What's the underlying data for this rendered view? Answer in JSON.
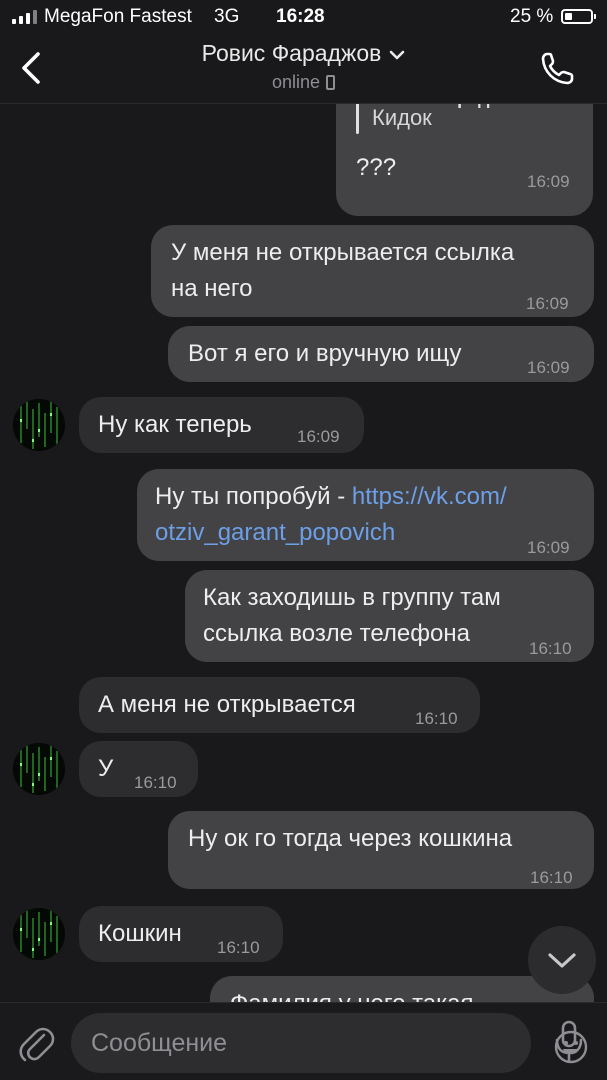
{
  "status_bar": {
    "carrier": "MegaFon Fastest",
    "network": "3G",
    "time": "16:28",
    "battery": "25 %"
  },
  "header": {
    "contact_name": "Ровис Фараджов",
    "status": "online"
  },
  "messages": [
    {
      "direction": "out",
      "reply_to_name": "Ровис Фараджов",
      "reply_to_text": "Кидок",
      "text": "???",
      "time": "16:09"
    },
    {
      "direction": "out",
      "text_lines": [
        "У меня не открывается ссылка",
        "на него"
      ],
      "time": "16:09"
    },
    {
      "direction": "out",
      "text": "Вот я его и вручную ищу",
      "time": "16:09"
    },
    {
      "direction": "in",
      "text": "Ну как теперь",
      "time": "16:09"
    },
    {
      "direction": "out",
      "text_prefix": "Ну ты попробуй - ",
      "link_line1": "https://vk.com/",
      "link_line2": "otziv_garant_popovich",
      "time": "16:09"
    },
    {
      "direction": "out",
      "text_lines": [
        "Как заходишь в группу там",
        "ссылка возле телефона"
      ],
      "time": "16:10"
    },
    {
      "direction": "in",
      "text": "А меня не открывается",
      "time": "16:10"
    },
    {
      "direction": "in",
      "text": "У",
      "time": "16:10"
    },
    {
      "direction": "out",
      "text": "Ну ок го тогда через кошкина",
      "time": "16:10"
    },
    {
      "direction": "in",
      "text": "Кошкин",
      "time": "16:10"
    },
    {
      "direction": "out",
      "text": "Фамилия у него такая",
      "partial": true
    }
  ],
  "input": {
    "placeholder": "Сообщение"
  },
  "colors": {
    "background": "#19191b",
    "outgoing_bubble": "#434345",
    "incoming_bubble": "#2d2d2f",
    "link": "#6d9fe8",
    "timestamp": "#9a9a9e"
  },
  "icons": [
    "back-chevron-icon",
    "chevron-down-icon",
    "phone-icon",
    "mobile-device-icon",
    "scroll-down-icon",
    "paperclip-icon",
    "emoji-icon",
    "microphone-icon"
  ]
}
